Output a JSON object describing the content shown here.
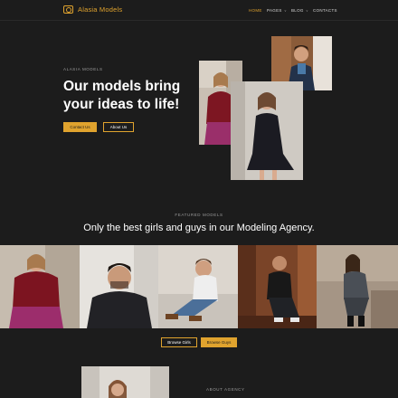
{
  "brand": {
    "name": "Alasia Models"
  },
  "nav": {
    "items": [
      {
        "label": "HOME"
      },
      {
        "label": "PAGES"
      },
      {
        "label": "BLOG"
      },
      {
        "label": "CONTACTS"
      }
    ]
  },
  "hero": {
    "eyebrow": "ALASIA MODELS",
    "title": "Our models bring your ideas to life!",
    "primary_button": "Contact Us",
    "secondary_button": "About Us"
  },
  "featured": {
    "eyebrow": "FEATURED MODELS",
    "title": "Only the best girls and guys in our Modeling Agency.",
    "browse_girls": "Browse Girls",
    "browse_guys": "Browse Guys"
  },
  "about": {
    "eyebrow": "ABOUT AGENCY"
  },
  "colors": {
    "accent": "#e0a32e",
    "background": "#1c1c1c"
  },
  "icons": {
    "logo": "camera-icon",
    "dropdown": "chevron-down-icon"
  }
}
